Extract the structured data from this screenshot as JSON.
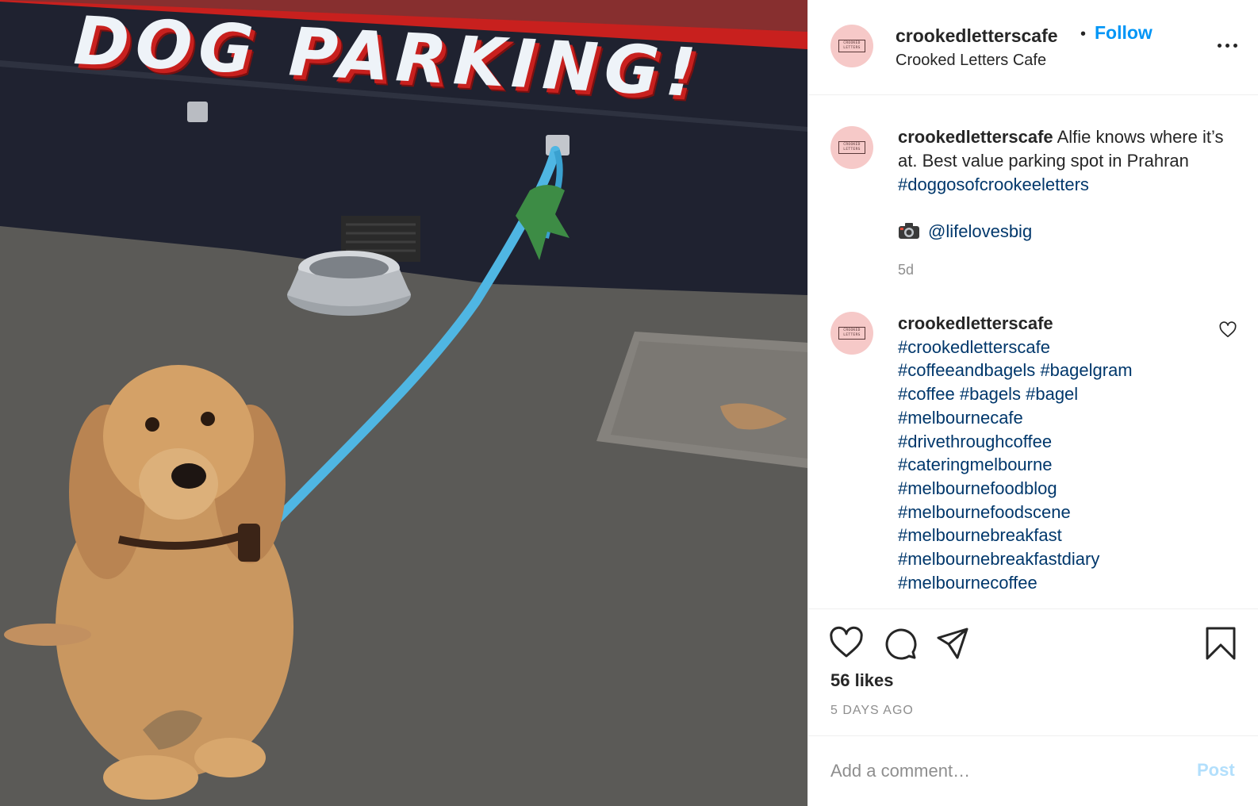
{
  "photo": {
    "sign_text": "DOG PARKING!",
    "alt": "Cocker spaniel tied to a wall under a dog parking sign"
  },
  "header": {
    "username": "crookedletterscafe",
    "separator": "•",
    "follow_label": "Follow",
    "location": "Crooked Letters Cafe",
    "avatar_text": "CROOKED LETTERS"
  },
  "caption": {
    "username": "crookedletterscafe",
    "text": "Alfie knows where it’s at. Best value parking spot in Prahran",
    "hashtag": "#doggosofcrookeeletters",
    "credit": "@lifelovesbig",
    "time": "5d"
  },
  "comment": {
    "username": "crookedletterscafe",
    "hashtags": [
      "#crookedletterscafe",
      "#coffeeandbagels",
      "#bagelgram",
      "#coffee",
      "#bagels",
      "#bagel",
      "#melbournecafe",
      "#drivethroughcoffee",
      "#cateringmelbourne",
      "#melbournefoodblog",
      "#melbournefoodscene",
      "#melbournebreakfast",
      "#melbournebreakfastdiary",
      "#melbournecoffee"
    ]
  },
  "actions": {
    "likes": "56 likes",
    "posted_ago": "5 DAYS AGO",
    "icons": [
      "heart-icon",
      "comment-icon",
      "share-icon",
      "bookmark-icon"
    ]
  },
  "add_comment": {
    "placeholder": "Add a comment…",
    "post_label": "Post"
  },
  "colors": {
    "link": "#0095f6",
    "hashtag": "#00376b",
    "muted": "#8e8e8e",
    "post_disabled": "#b2dffc",
    "avatar_bg": "#f6c9c8"
  }
}
